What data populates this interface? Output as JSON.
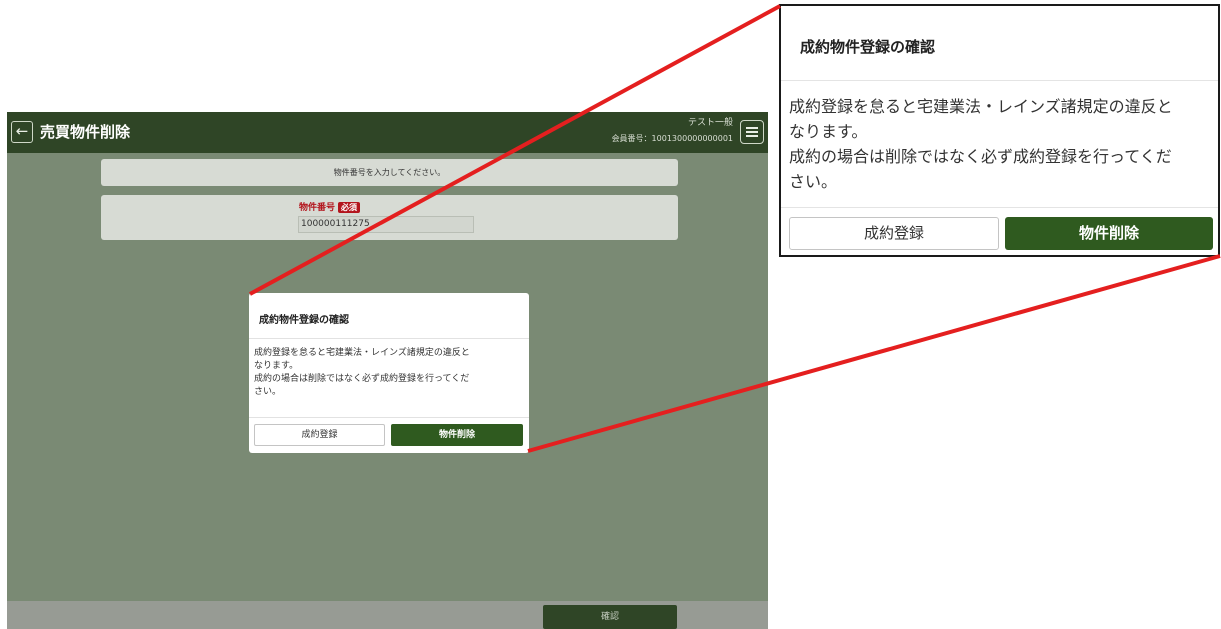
{
  "app": {
    "title": "売買物件削除",
    "back_icon": "arrow-left-icon",
    "user_name": "テスト一般",
    "member_no": "会員番号：1001300000000001",
    "menu_icon": "hamburger-menu-icon",
    "instruction": "物件番号を入力してください。",
    "field_label": "物件番号",
    "required_badge": "必須",
    "property_number": "100000111275",
    "confirm_label": "確認"
  },
  "modal": {
    "title": "成約物件登録の確認",
    "body_line1": "成約登録を怠ると宅建業法・レインズ諸規定の違反と",
    "body_line2": "なります。",
    "body_line3": "成約の場合は削除ではなく必ず成約登録を行ってくだ",
    "body_line4": "さい。",
    "register_label": "成約登録",
    "delete_label": "物件削除"
  },
  "colors": {
    "header": "#2f4526",
    "primary_button": "#2f5a1f",
    "overlay": "#7a8a74",
    "required": "#b3151d",
    "callout_line": "#e41f1f"
  }
}
